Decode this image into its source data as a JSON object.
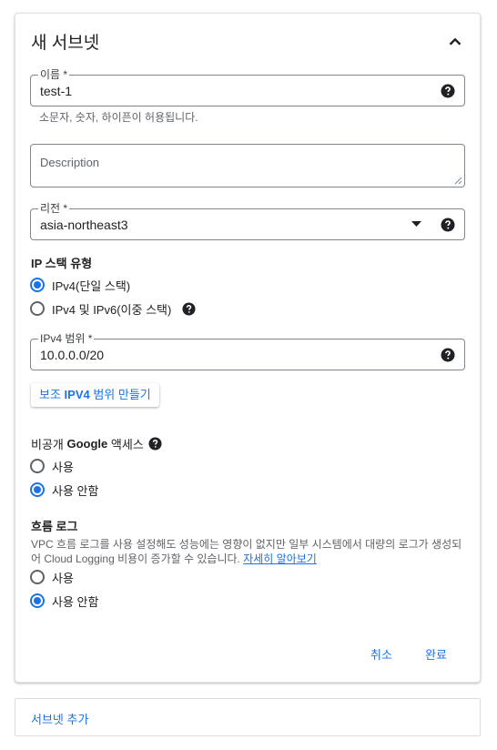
{
  "card": {
    "title": "새 서브넷",
    "name_field": {
      "label": "이름 *",
      "value": "test-1",
      "hint": "소문자, 숫자, 하이픈이 허용됩니다."
    },
    "description_field": {
      "placeholder": "Description"
    },
    "region_field": {
      "label": "리전 *",
      "value": "asia-northeast3"
    },
    "ip_stack": {
      "title": "IP 스택 유형",
      "options": [
        {
          "label": "IPv4(단일 스택)",
          "selected": true
        },
        {
          "label": "IPv4 및 IPv6(이중 스택)",
          "selected": false
        }
      ]
    },
    "ipv4_range_field": {
      "label": "IPv4 범위 *",
      "value": "10.0.0.0/20"
    },
    "secondary_range_button": {
      "prefix": "보조 ",
      "bold": "IPV4",
      "suffix": " 범위 만들기"
    },
    "private_google_access": {
      "title_prefix": "비공개 ",
      "title_bold": "Google",
      "title_suffix": " 액세스",
      "options": [
        {
          "label": "사용",
          "selected": false
        },
        {
          "label": "사용 안함",
          "selected": true
        }
      ]
    },
    "flow_logs": {
      "title": "흐름 로그",
      "description": "VPC 흐름 로그를 사용 설정해도 성능에는 영향이 없지만 일부 시스템에서 대량의 로그가 생성되어 Cloud Logging 비용이 증가할 수 있습니다. ",
      "learn_more": "자세히 알아보기",
      "options": [
        {
          "label": "사용",
          "selected": false
        },
        {
          "label": "사용 안함",
          "selected": true
        }
      ]
    },
    "cancel_label": "취소",
    "done_label": "완료"
  },
  "add_subnet_label": "서브넷 추가",
  "colors": {
    "accent": "#1a73e8",
    "text": "#202124",
    "secondary_text": "#5f6368",
    "border": "#80868b"
  },
  "icons": [
    "chevron-up-icon",
    "help-icon",
    "dropdown-arrow-icon",
    "resize-handle-icon"
  ]
}
